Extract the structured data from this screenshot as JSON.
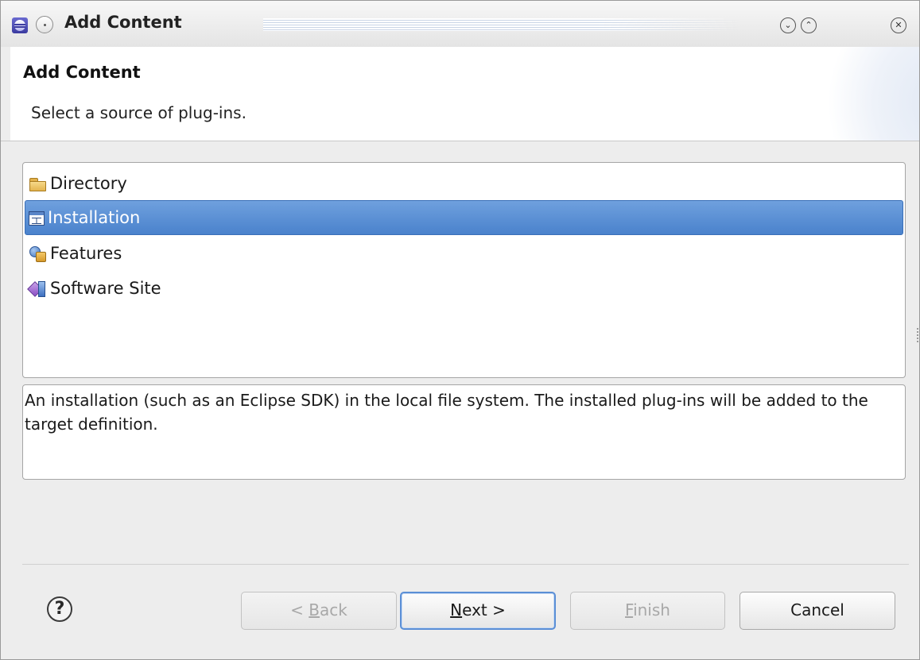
{
  "window": {
    "title": "Add Content",
    "title_controls": {
      "minimize_glyph": "⌄",
      "maximize_glyph": "⌃",
      "close_glyph": "✕"
    }
  },
  "banner": {
    "title": "Add Content",
    "description": "Select a source of plug-ins."
  },
  "sources": {
    "items": [
      {
        "label": "Directory",
        "icon": "folder-icon",
        "selected": false
      },
      {
        "label": "Installation",
        "icon": "installation-icon",
        "selected": true
      },
      {
        "label": "Features",
        "icon": "features-icon",
        "selected": false
      },
      {
        "label": "Software Site",
        "icon": "software-site-icon",
        "selected": false
      }
    ]
  },
  "description_box": {
    "text": "An installation (such as an Eclipse SDK) in the local file system. The installed plug-ins will be added to the target definition."
  },
  "buttons": {
    "help_glyph": "?",
    "back": {
      "prefix": "< ",
      "mnemonic": "B",
      "rest": "ack",
      "enabled": false
    },
    "next": {
      "prefix": "",
      "mnemonic": "N",
      "rest": "ext >",
      "enabled": true
    },
    "finish": {
      "prefix": "",
      "mnemonic": "F",
      "rest": "inish",
      "enabled": false
    },
    "cancel": {
      "label": "Cancel",
      "enabled": true
    }
  },
  "colors": {
    "selection": "#4a82cc",
    "default_button_border": "#5b8fd6",
    "dialog_bg": "#ededed"
  }
}
